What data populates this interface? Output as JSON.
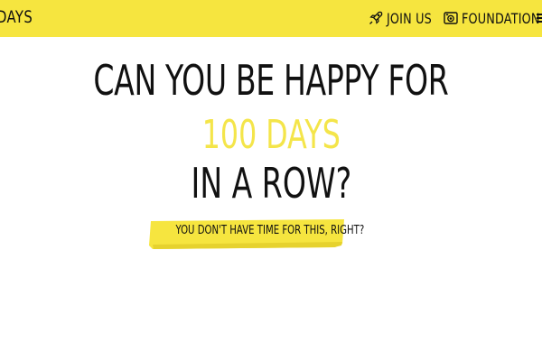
{
  "header": {
    "brand": "DAYS",
    "nav": [
      {
        "label": "JOIN US",
        "icon": "rocket-icon"
      },
      {
        "label": "FOUNDATION",
        "icon": "camera-icon"
      }
    ],
    "background_color": "#f6e53f"
  },
  "hero": {
    "line1": "CAN YOU BE HAPPY FOR",
    "line2": "100 DAYS",
    "line3": "IN A ROW?",
    "accent_color": "#f4e54a",
    "cta_label": "YOU DON'T HAVE TIME FOR THIS, RIGHT?"
  }
}
